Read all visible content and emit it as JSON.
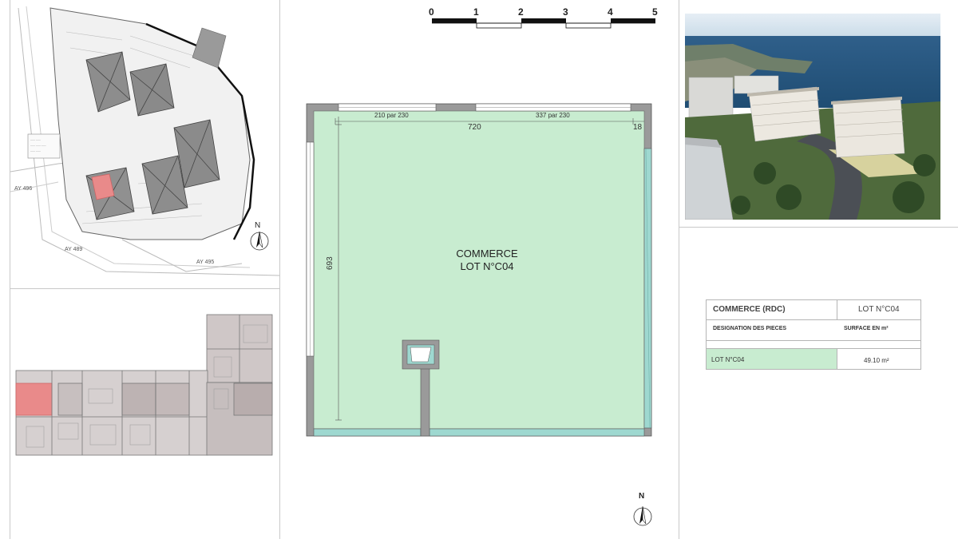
{
  "site_plan": {
    "labels": [
      "AY 496",
      "AY 495",
      "AY 489"
    ],
    "north_label": "N"
  },
  "plan": {
    "room_name": "COMMERCE",
    "lot_label": "LOT N°C04",
    "window_left": "210 par 230",
    "window_right": "337 par 230",
    "width_dim": "720",
    "right_dim": "18",
    "height_dim": "693",
    "north_label": "N"
  },
  "scale_bar": {
    "ticks": [
      "0",
      "1",
      "2",
      "3",
      "4",
      "5"
    ]
  },
  "table": {
    "title": "COMMERCE (RDC)",
    "lot_header": "LOT N°C04",
    "designation_header": "DESIGNATION DES PIECES",
    "surface_header": "SURFACE EN m²",
    "row_name": "LOT N°C04",
    "row_surface": "49.10 m²"
  },
  "colors": {
    "room_fill": "#c8ecd0",
    "highlight_red": "#e98a8a",
    "wall_gray": "#9a9a9a",
    "glazing_teal": "#9ed8d0"
  }
}
